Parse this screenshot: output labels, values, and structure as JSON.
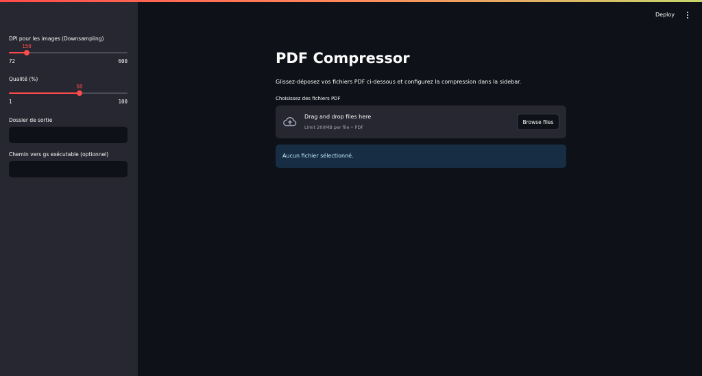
{
  "colors": {
    "accent": "#ff4b4b",
    "sidebar_bg": "#262730",
    "main_bg": "#0e1117",
    "info_bg": "#172d43",
    "info_text": "#c7ebff"
  },
  "header": {
    "deploy_label": "Deploy",
    "menu_icon": "vertical-dots-icon"
  },
  "sidebar": {
    "dpi_slider": {
      "label": "DPI pour les images (Downsampling)",
      "value": 150,
      "value_text": "150",
      "min": 72,
      "min_text": "72",
      "max": 600,
      "max_text": "600"
    },
    "quality_slider": {
      "label": "Qualité (%)",
      "value": 60,
      "value_text": "60",
      "min": 1,
      "min_text": "1",
      "max": 100,
      "max_text": "100"
    },
    "output_folder": {
      "label": "Dossier de sortie",
      "value": ""
    },
    "gs_path": {
      "label": "Chemin vers gs exécutable (optionnel)",
      "value": ""
    }
  },
  "main": {
    "title": "PDF Compressor",
    "description": "Glissez-déposez vos fichiers PDF ci-dessous et configurez la compression dans la sidebar.",
    "uploader": {
      "label": "Choisissez des fichiers PDF",
      "icon": "cloud-upload-icon",
      "drop_text": "Drag and drop files here",
      "limit_text": "Limit 200MB per file • PDF",
      "browse_label": "Browse files"
    },
    "info_message": "Aucun fichier sélectionné."
  }
}
